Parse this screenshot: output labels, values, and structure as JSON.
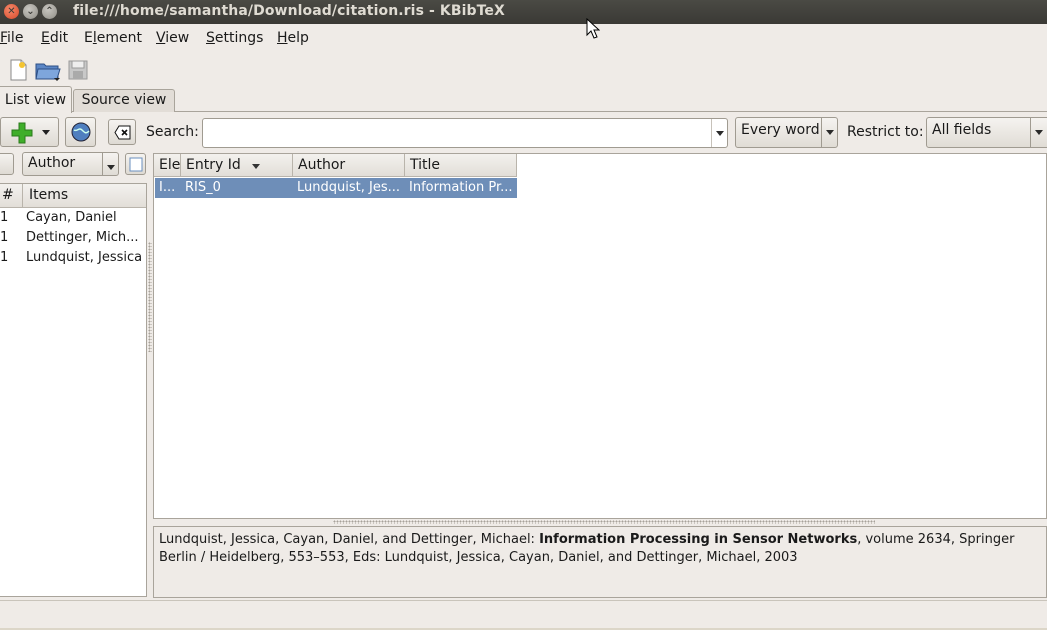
{
  "window": {
    "title": "file:///home/samantha/Download/citation.ris - KBibTeX",
    "buttons": [
      "close",
      "minimize",
      "maximize"
    ]
  },
  "menubar": {
    "items": [
      {
        "label": "File",
        "mnemonic": "F"
      },
      {
        "label": "Edit",
        "mnemonic": "E"
      },
      {
        "label": "Element",
        "mnemonic": "l"
      },
      {
        "label": "View",
        "mnemonic": "V"
      },
      {
        "label": "Settings",
        "mnemonic": "S"
      },
      {
        "label": "Help",
        "mnemonic": "H"
      }
    ]
  },
  "toolbar": {
    "icons": [
      "new-document-icon",
      "open-folder-icon",
      "save-icon"
    ]
  },
  "tabs": [
    {
      "label": "List view",
      "active": true
    },
    {
      "label": "Source view",
      "active": false
    }
  ],
  "search": {
    "label": "Search:",
    "value": "",
    "mode": "Every word",
    "restrict_label": "Restrict to:",
    "restrict_value": "All fields"
  },
  "sidebar": {
    "field": "Author",
    "columns": [
      "#",
      "Items"
    ],
    "items": [
      {
        "count": "1",
        "name": "Cayan, Daniel"
      },
      {
        "count": "1",
        "name": "Dettinger, Mich..."
      },
      {
        "count": "1",
        "name": "Lundquist, Jessica"
      }
    ]
  },
  "table": {
    "columns": [
      "Ele",
      "Entry Id",
      "Author",
      "Title"
    ],
    "rows": [
      {
        "element": "I...",
        "entry_id": "RIS_0",
        "author": "Lundquist, Jes...",
        "title": "Information Pr...",
        "selected": true
      }
    ]
  },
  "preview": {
    "authors": "Lundquist, Jessica, Cayan, Daniel, and Dettinger, Michael: ",
    "title": "Information Processing in Sensor Networks",
    "rest_line1": ", volume 2634, Springer",
    "rest_line2": "Berlin / Heidelberg, 553–553, Eds: Lundquist, Jessica, Cayan, Daniel, and Dettinger, Michael, 2003"
  },
  "colors": {
    "titlebar": "#3c3b37",
    "selection": "#6e8eb8",
    "window_bg": "#efebe7"
  }
}
